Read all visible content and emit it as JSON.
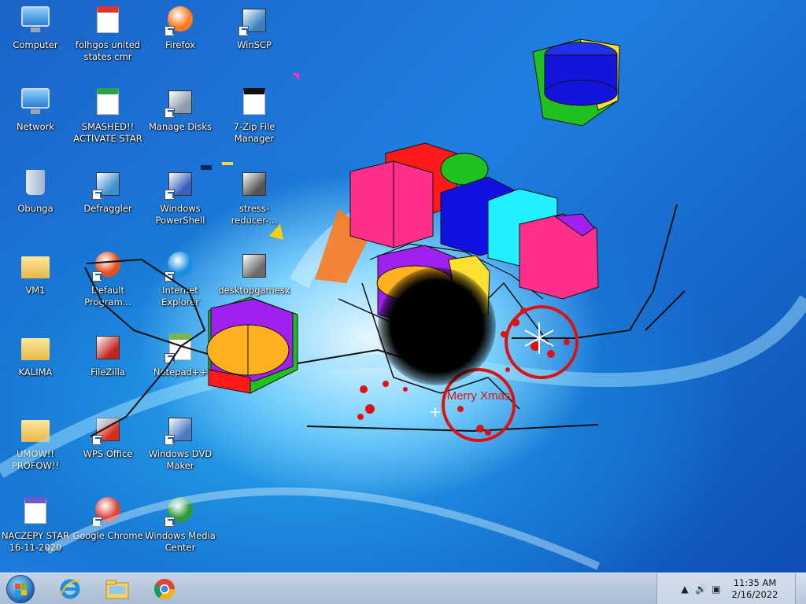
{
  "desktop_icons": [
    {
      "label": "Computer",
      "icon": "computer-icon",
      "shortcut": false
    },
    {
      "label": "folhgos united states cmr",
      "icon": "pdf-document-icon",
      "shortcut": false
    },
    {
      "label": "Firefox",
      "icon": "firefox-icon",
      "shortcut": true
    },
    {
      "label": "WinSCP",
      "icon": "winscp-icon",
      "shortcut": true
    },
    {
      "label": "Network",
      "icon": "network-icon",
      "shortcut": false
    },
    {
      "label": "SMASHED!! ACTIVATE STAR",
      "icon": "spreadsheet-icon",
      "shortcut": false
    },
    {
      "label": "Manage Disks",
      "icon": "manage-disks-icon",
      "shortcut": true
    },
    {
      "label": "7-Zip File Manager",
      "icon": "7zip-icon",
      "shortcut": false
    },
    {
      "label": "Obunga",
      "icon": "recycle-bin-icon",
      "shortcut": false
    },
    {
      "label": "Defraggler",
      "icon": "defraggler-icon",
      "shortcut": true
    },
    {
      "label": "Windows PowerShell",
      "icon": "powershell-icon",
      "shortcut": true
    },
    {
      "label": "stress-reducer-...",
      "icon": "stress-reducer-icon",
      "shortcut": false
    },
    {
      "label": "VM1",
      "icon": "folder-icon",
      "shortcut": false
    },
    {
      "label": "Default Program...",
      "icon": "default-programs-icon",
      "shortcut": true
    },
    {
      "label": "Internet Explorer",
      "icon": "internet-explorer-icon",
      "shortcut": true
    },
    {
      "label": "desktopgamesx",
      "icon": "desktopgames-icon",
      "shortcut": false
    },
    {
      "label": "KALIMA",
      "icon": "folder-icon",
      "shortcut": false
    },
    {
      "label": "FileZilla",
      "icon": "filezilla-icon",
      "shortcut": false
    },
    {
      "label": "Notepad++",
      "icon": "notepadpp-icon",
      "shortcut": true
    },
    {
      "label": "UMOW!! PROFOW!!",
      "icon": "folder-icon",
      "shortcut": false
    },
    {
      "label": "WPS Office",
      "icon": "wps-office-icon",
      "shortcut": true
    },
    {
      "label": "Windows DVD Maker",
      "icon": "dvd-maker-icon",
      "shortcut": true
    },
    {
      "label": "NACZEPY STAR 16-11-2020",
      "icon": "word-document-icon",
      "shortcut": false
    },
    {
      "label": "Google Chrome",
      "icon": "chrome-icon",
      "shortcut": true
    },
    {
      "label": "Windows Media Center",
      "icon": "media-center-icon",
      "shortcut": true
    }
  ],
  "overlay": {
    "stamp_text": "Merry Xmas"
  },
  "taskbar": {
    "pinned": [
      {
        "name": "internet-explorer-icon"
      },
      {
        "name": "file-explorer-icon"
      },
      {
        "name": "chrome-icon"
      }
    ],
    "clock_time": "11:35 AM",
    "clock_date": "2/16/2022",
    "tray_icons": [
      "show-hidden-icons-icon",
      "volume-icon",
      "network-icon"
    ]
  },
  "colors": {
    "wallpaper_blue": "#1b64c8",
    "taskbar": "#bccadb",
    "gift_pink": "#ff2f8a",
    "gift_red": "#ff1a1a",
    "gift_blue": "#1010e0",
    "gift_cyan": "#20f0ff",
    "gift_purple": "#a020f0",
    "gift_yellow": "#ffe030",
    "gift_green": "#20c020",
    "stamp_red": "#e01010"
  }
}
